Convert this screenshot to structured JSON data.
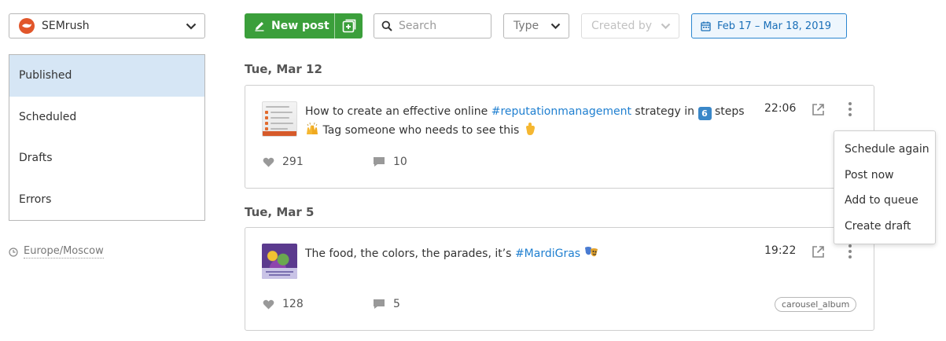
{
  "account": {
    "name": "SEMrush",
    "logo_icon": "semrush-fire-logo-icon",
    "chevron_icon": "chevron-down-icon"
  },
  "sidebar": {
    "items": [
      {
        "label": "Published",
        "active": true
      },
      {
        "label": "Scheduled",
        "active": false
      },
      {
        "label": "Drafts",
        "active": false
      },
      {
        "label": "Errors",
        "active": false
      }
    ]
  },
  "timezone": {
    "icon": "clock-icon",
    "label": "Europe/Moscow"
  },
  "toolbar": {
    "new_post_label": "New post",
    "new_post_icon": "pencil-icon",
    "add_icon": "plus-square-icon",
    "search_placeholder": "Search",
    "search_icon": "search-icon",
    "type_label": "Type",
    "created_by_label": "Created by",
    "date_range_label": "Feb 17 – Mar 18, 2019",
    "calendar_icon": "calendar-icon"
  },
  "colors": {
    "accent_green": "#3b9f3b",
    "link_blue": "#1f7fd0",
    "active_bg": "#d6e6f5",
    "brand_orange": "#e1562a"
  },
  "feed": {
    "days": [
      {
        "heading": "Tue, Mar 12",
        "post": {
          "text_before": "How to create an effective online ",
          "hashtag": "#reputationmanagement",
          "text_after": " strategy in ",
          "keycap": "6",
          "text_after_keycap": " steps",
          "line2": "Tag someone who needs to see this",
          "time": "22:06",
          "likes": "291",
          "comments": "10"
        }
      },
      {
        "heading": "Tue, Mar 5",
        "post": {
          "text_before": "The food, the colors, the parades, it’s ",
          "hashtag": "#MardiGras",
          "time": "19:22",
          "likes": "128",
          "comments": "5",
          "badge": "carousel_album"
        }
      }
    ]
  },
  "context_menu": {
    "items": [
      "Schedule again",
      "Post now",
      "Add to queue",
      "Create draft"
    ]
  }
}
